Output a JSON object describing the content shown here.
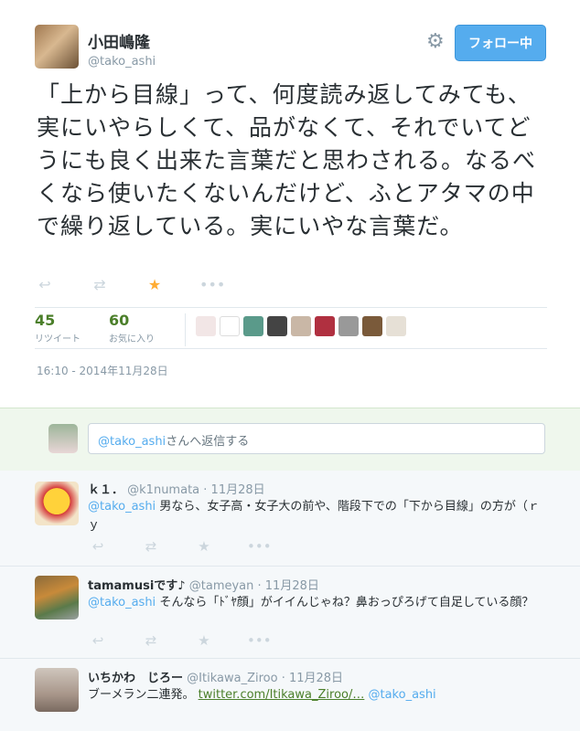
{
  "tweet": {
    "author_name": "小田嶋隆",
    "author_handle": "@tako_ashi",
    "follow_label": "フォロー中",
    "text": "「上から目線」って、何度読み返してみても、実にいやらしくて、品がなくて、それでいてどうにも良く出来た言葉だと思わされる。なるべくなら使いたくないんだけど、ふとアタマの中で繰り返している。実にいやな言葉だ。",
    "retweets": "45",
    "retweets_label": "リツイート",
    "favorites": "60",
    "favorites_label": "お気に入り",
    "timestamp": "16:10 - 2014年11月28日"
  },
  "reply_box": {
    "mention": "@tako_ashi",
    "suffix": "さんへ返信する"
  },
  "replies": [
    {
      "name": "ｋ１．",
      "handle": "@k1numata",
      "date": "· 11月28日",
      "mention": "@tako_ashi",
      "text": " 男なら、女子高・女子大の前や、階段下での「下から目線」の方が（ｒｙ"
    },
    {
      "name": "tamamusiです♪",
      "handle": "@tameyan",
      "date": "· 11月28日",
      "mention": "@tako_ashi",
      "text": " そんなら「ﾄﾞﾔ顔」がイイんじゃね？鼻おっぴろげて自足している顔？"
    },
    {
      "name": "いちかわ　じろー",
      "handle": "@Itikawa_Ziroo",
      "date": "· 11月28日",
      "text": "ブーメラン二連発。 ",
      "link": "twitter.com/Itikawa_Ziroo/…",
      "mention": " @tako_ashi"
    }
  ],
  "icons": {
    "reply": "reply-icon",
    "retweet": "retweet-icon",
    "favorite": "star-icon",
    "more": "more-icon",
    "settings": "gear-icon"
  },
  "colors": {
    "accent": "#55acee",
    "favorite": "#ffac33",
    "stat_green": "#4b7f2a",
    "reply_bg": "#eff7ed"
  }
}
